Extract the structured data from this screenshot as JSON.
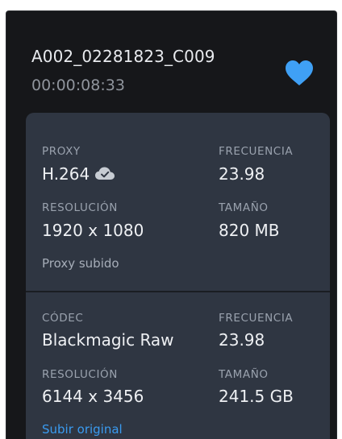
{
  "clip": {
    "name": "A002_02281823_C009",
    "duration": "00:00:08:33",
    "favorite_icon": "heart-icon",
    "favorite_color": "#3fa0f5"
  },
  "proxy": {
    "proxy_label": "PROXY",
    "proxy_value": "H.264",
    "proxy_icon": "cloud-check-icon",
    "framerate_label": "FRECUENCIA",
    "framerate_value": "23.98",
    "resolution_label": "RESOLUCIÓN",
    "resolution_value": "1920 x 1080",
    "size_label": "TAMAÑO",
    "size_value": "820 MB",
    "status": "Proxy subido"
  },
  "original": {
    "codec_label": "CÓDEC",
    "codec_value": "Blackmagic Raw",
    "framerate_label": "FRECUENCIA",
    "framerate_value": "23.98",
    "resolution_label": "RESOLUCIÓN",
    "resolution_value": "6144 x 3456",
    "size_label": "TAMAÑO",
    "size_value": "241.5 GB",
    "upload_link": "Subir original",
    "link_color": "#3a9bf0"
  }
}
